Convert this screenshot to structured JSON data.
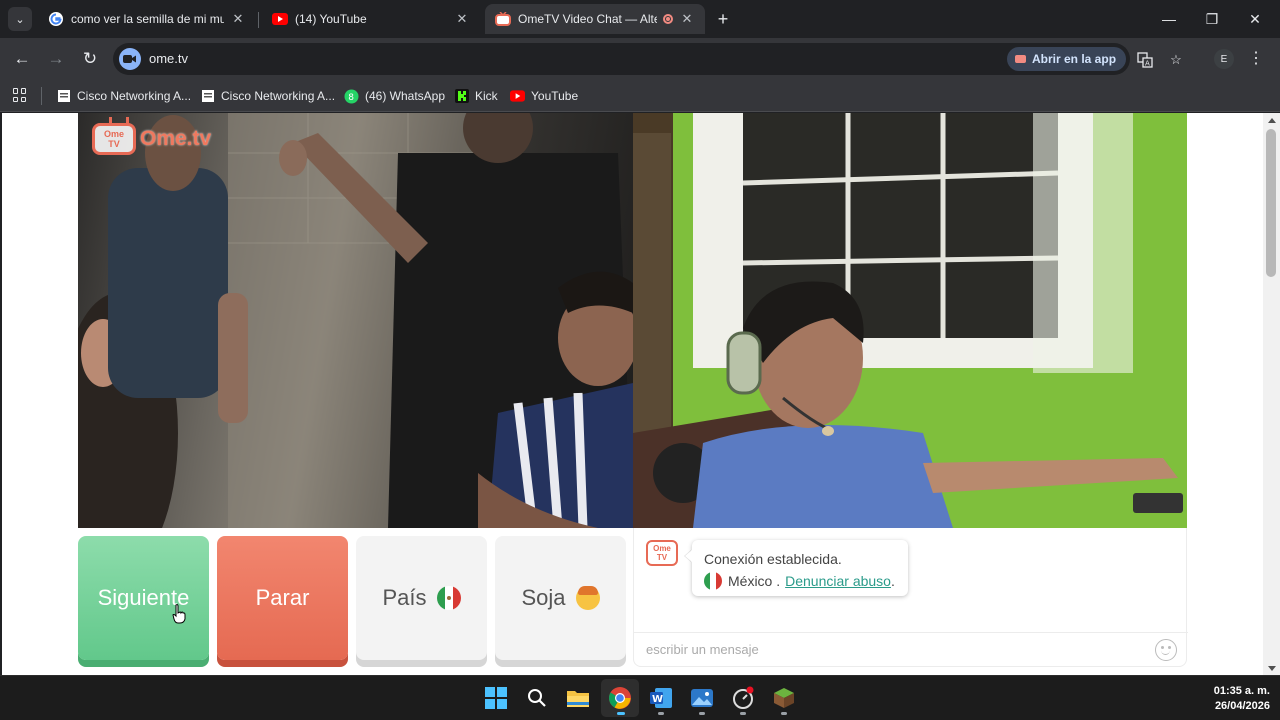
{
  "browser": {
    "tabs": [
      {
        "title": "como ver la semilla de mi mundo",
        "favicon": "google-icon",
        "active": false
      },
      {
        "title": "(14) YouTube",
        "favicon": "youtube-icon",
        "active": false
      },
      {
        "title": "OmeTV Video Chat — Alter",
        "favicon": "ometv-icon",
        "active": true,
        "recording": true
      }
    ],
    "tab_close_glyph": "✕",
    "new_tab_glyph": "+",
    "window_controls": {
      "minimize": "—",
      "restore": "❐",
      "close": "✕"
    },
    "url": "ome.tv",
    "open_in_app_label": "Abrir en la app",
    "profile_initial": "E",
    "bookmarks": [
      {
        "label": "Cisco Networking A...",
        "icon": "cisco-page-icon"
      },
      {
        "label": "Cisco Networking A...",
        "icon": "cisco-page-icon"
      },
      {
        "label": "(46) WhatsApp",
        "icon": "whatsapp-icon",
        "badge": "8"
      },
      {
        "label": "Kick",
        "icon": "kick-icon"
      },
      {
        "label": "YouTube",
        "icon": "youtube-icon"
      }
    ]
  },
  "ometv": {
    "logo_text": "Ome.tv",
    "logo_box_line1": "Ome",
    "logo_box_line2": "TV",
    "buttons": {
      "next": "Siguiente",
      "stop": "Parar",
      "country": "País",
      "gender": "Soja"
    },
    "colors": {
      "next": "#62c88b",
      "stop": "#e56a52",
      "link": "#2a9b8a",
      "brand": "#e76a55"
    },
    "chat": {
      "status": "Conexión establecida.",
      "country": "México .",
      "report_link": "Denunciar abuso",
      "report_suffix": ".",
      "input_placeholder": "escribir un mensaje"
    }
  },
  "taskbar": {
    "apps": [
      "windows-start-icon",
      "search-icon",
      "file-explorer-icon",
      "chrome-icon",
      "word-icon",
      "photos-icon",
      "speedometer-icon",
      "minecraft-icon"
    ],
    "time": "01:35 a. m.",
    "date": "26/04/2026"
  }
}
